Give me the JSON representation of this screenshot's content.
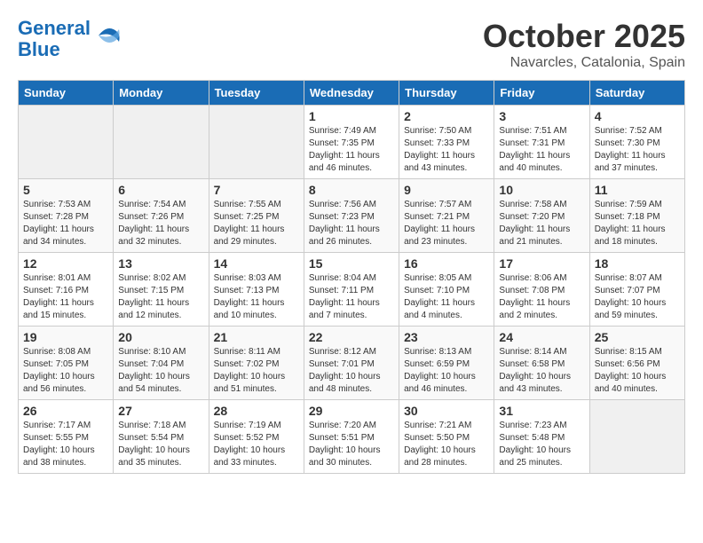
{
  "header": {
    "logo_line1": "General",
    "logo_line2": "Blue",
    "month": "October 2025",
    "location": "Navarcles, Catalonia, Spain"
  },
  "days_of_week": [
    "Sunday",
    "Monday",
    "Tuesday",
    "Wednesday",
    "Thursday",
    "Friday",
    "Saturday"
  ],
  "weeks": [
    [
      {
        "day": "",
        "info": ""
      },
      {
        "day": "",
        "info": ""
      },
      {
        "day": "",
        "info": ""
      },
      {
        "day": "1",
        "info": "Sunrise: 7:49 AM\nSunset: 7:35 PM\nDaylight: 11 hours and 46 minutes."
      },
      {
        "day": "2",
        "info": "Sunrise: 7:50 AM\nSunset: 7:33 PM\nDaylight: 11 hours and 43 minutes."
      },
      {
        "day": "3",
        "info": "Sunrise: 7:51 AM\nSunset: 7:31 PM\nDaylight: 11 hours and 40 minutes."
      },
      {
        "day": "4",
        "info": "Sunrise: 7:52 AM\nSunset: 7:30 PM\nDaylight: 11 hours and 37 minutes."
      }
    ],
    [
      {
        "day": "5",
        "info": "Sunrise: 7:53 AM\nSunset: 7:28 PM\nDaylight: 11 hours and 34 minutes."
      },
      {
        "day": "6",
        "info": "Sunrise: 7:54 AM\nSunset: 7:26 PM\nDaylight: 11 hours and 32 minutes."
      },
      {
        "day": "7",
        "info": "Sunrise: 7:55 AM\nSunset: 7:25 PM\nDaylight: 11 hours and 29 minutes."
      },
      {
        "day": "8",
        "info": "Sunrise: 7:56 AM\nSunset: 7:23 PM\nDaylight: 11 hours and 26 minutes."
      },
      {
        "day": "9",
        "info": "Sunrise: 7:57 AM\nSunset: 7:21 PM\nDaylight: 11 hours and 23 minutes."
      },
      {
        "day": "10",
        "info": "Sunrise: 7:58 AM\nSunset: 7:20 PM\nDaylight: 11 hours and 21 minutes."
      },
      {
        "day": "11",
        "info": "Sunrise: 7:59 AM\nSunset: 7:18 PM\nDaylight: 11 hours and 18 minutes."
      }
    ],
    [
      {
        "day": "12",
        "info": "Sunrise: 8:01 AM\nSunset: 7:16 PM\nDaylight: 11 hours and 15 minutes."
      },
      {
        "day": "13",
        "info": "Sunrise: 8:02 AM\nSunset: 7:15 PM\nDaylight: 11 hours and 12 minutes."
      },
      {
        "day": "14",
        "info": "Sunrise: 8:03 AM\nSunset: 7:13 PM\nDaylight: 11 hours and 10 minutes."
      },
      {
        "day": "15",
        "info": "Sunrise: 8:04 AM\nSunset: 7:11 PM\nDaylight: 11 hours and 7 minutes."
      },
      {
        "day": "16",
        "info": "Sunrise: 8:05 AM\nSunset: 7:10 PM\nDaylight: 11 hours and 4 minutes."
      },
      {
        "day": "17",
        "info": "Sunrise: 8:06 AM\nSunset: 7:08 PM\nDaylight: 11 hours and 2 minutes."
      },
      {
        "day": "18",
        "info": "Sunrise: 8:07 AM\nSunset: 7:07 PM\nDaylight: 10 hours and 59 minutes."
      }
    ],
    [
      {
        "day": "19",
        "info": "Sunrise: 8:08 AM\nSunset: 7:05 PM\nDaylight: 10 hours and 56 minutes."
      },
      {
        "day": "20",
        "info": "Sunrise: 8:10 AM\nSunset: 7:04 PM\nDaylight: 10 hours and 54 minutes."
      },
      {
        "day": "21",
        "info": "Sunrise: 8:11 AM\nSunset: 7:02 PM\nDaylight: 10 hours and 51 minutes."
      },
      {
        "day": "22",
        "info": "Sunrise: 8:12 AM\nSunset: 7:01 PM\nDaylight: 10 hours and 48 minutes."
      },
      {
        "day": "23",
        "info": "Sunrise: 8:13 AM\nSunset: 6:59 PM\nDaylight: 10 hours and 46 minutes."
      },
      {
        "day": "24",
        "info": "Sunrise: 8:14 AM\nSunset: 6:58 PM\nDaylight: 10 hours and 43 minutes."
      },
      {
        "day": "25",
        "info": "Sunrise: 8:15 AM\nSunset: 6:56 PM\nDaylight: 10 hours and 40 minutes."
      }
    ],
    [
      {
        "day": "26",
        "info": "Sunrise: 7:17 AM\nSunset: 5:55 PM\nDaylight: 10 hours and 38 minutes."
      },
      {
        "day": "27",
        "info": "Sunrise: 7:18 AM\nSunset: 5:54 PM\nDaylight: 10 hours and 35 minutes."
      },
      {
        "day": "28",
        "info": "Sunrise: 7:19 AM\nSunset: 5:52 PM\nDaylight: 10 hours and 33 minutes."
      },
      {
        "day": "29",
        "info": "Sunrise: 7:20 AM\nSunset: 5:51 PM\nDaylight: 10 hours and 30 minutes."
      },
      {
        "day": "30",
        "info": "Sunrise: 7:21 AM\nSunset: 5:50 PM\nDaylight: 10 hours and 28 minutes."
      },
      {
        "day": "31",
        "info": "Sunrise: 7:23 AM\nSunset: 5:48 PM\nDaylight: 10 hours and 25 minutes."
      },
      {
        "day": "",
        "info": ""
      }
    ]
  ]
}
